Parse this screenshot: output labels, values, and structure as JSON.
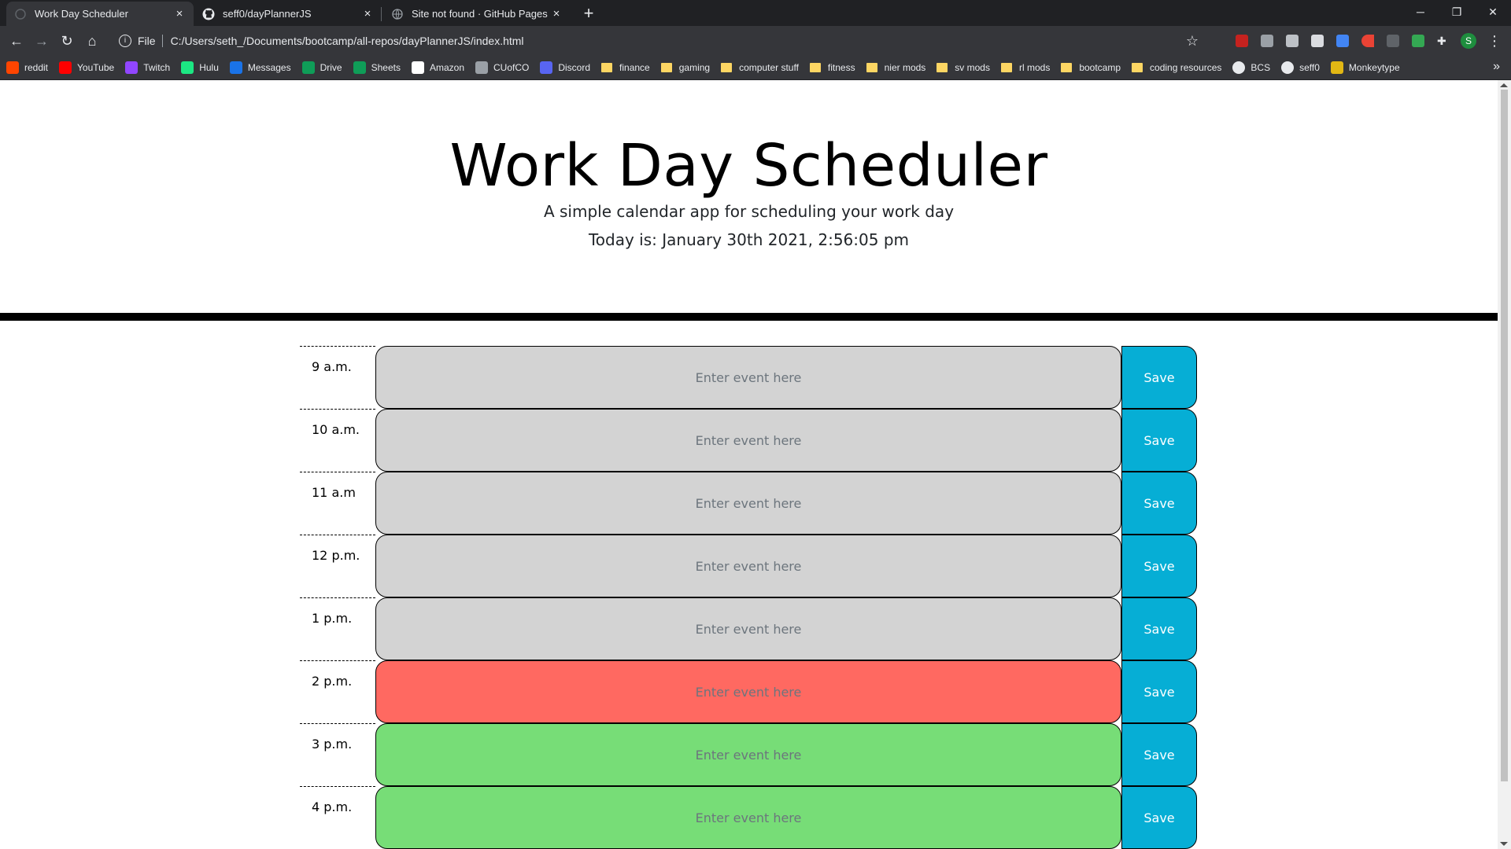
{
  "browser": {
    "tabs": [
      {
        "title": "Work Day Scheduler",
        "active": true
      },
      {
        "title": "seff0/dayPlannerJS",
        "active": false
      },
      {
        "title": "Site not found · GitHub Pages",
        "active": false
      }
    ],
    "address": {
      "scheme": "File",
      "url": "C:/Users/seth_/Documents/bootcamp/all-repos/dayPlannerJS/index.html"
    },
    "profile_initial": "S",
    "bookmarks": [
      {
        "label": "reddit",
        "icon": "reddit-icon"
      },
      {
        "label": "YouTube",
        "icon": "youtube-icon"
      },
      {
        "label": "Twitch",
        "icon": "twitch-icon"
      },
      {
        "label": "Hulu",
        "icon": "hulu-icon"
      },
      {
        "label": "Messages",
        "icon": "messages-icon"
      },
      {
        "label": "Drive",
        "icon": "drive-icon"
      },
      {
        "label": "Sheets",
        "icon": "sheets-icon"
      },
      {
        "label": "Amazon",
        "icon": "amazon-icon"
      },
      {
        "label": "CUofCO",
        "icon": "cuofco-icon"
      },
      {
        "label": "Discord",
        "icon": "discord-icon"
      },
      {
        "label": "finance",
        "icon": "folder-icon"
      },
      {
        "label": "gaming",
        "icon": "folder-icon"
      },
      {
        "label": "computer stuff",
        "icon": "folder-icon"
      },
      {
        "label": "fitness",
        "icon": "folder-icon"
      },
      {
        "label": "nier mods",
        "icon": "folder-icon"
      },
      {
        "label": "sv mods",
        "icon": "folder-icon"
      },
      {
        "label": "rl mods",
        "icon": "folder-icon"
      },
      {
        "label": "bootcamp",
        "icon": "folder-icon"
      },
      {
        "label": "coding resources",
        "icon": "folder-icon"
      },
      {
        "label": "BCS",
        "icon": "bcs-icon"
      },
      {
        "label": "seff0",
        "icon": "github-icon"
      },
      {
        "label": "Monkeytype",
        "icon": "monkeytype-icon"
      }
    ]
  },
  "page": {
    "title": "Work Day Scheduler",
    "lead": "A simple calendar app for scheduling your work day",
    "today": "Today is: January 30th 2021, 2:56:05 pm",
    "placeholder": "Enter event here",
    "save_label": "Save",
    "colors": {
      "past": "#d3d3d3",
      "present": "#ff6961",
      "future": "#77dd77",
      "save": "#06aed5"
    },
    "hours": [
      {
        "label": "9 a.m.",
        "state": "past"
      },
      {
        "label": "10 a.m.",
        "state": "past"
      },
      {
        "label": "11 a.m",
        "state": "past"
      },
      {
        "label": "12 p.m.",
        "state": "past"
      },
      {
        "label": "1 p.m.",
        "state": "past"
      },
      {
        "label": "2 p.m.",
        "state": "present"
      },
      {
        "label": "3 p.m.",
        "state": "future"
      },
      {
        "label": "4 p.m.",
        "state": "future"
      }
    ]
  }
}
